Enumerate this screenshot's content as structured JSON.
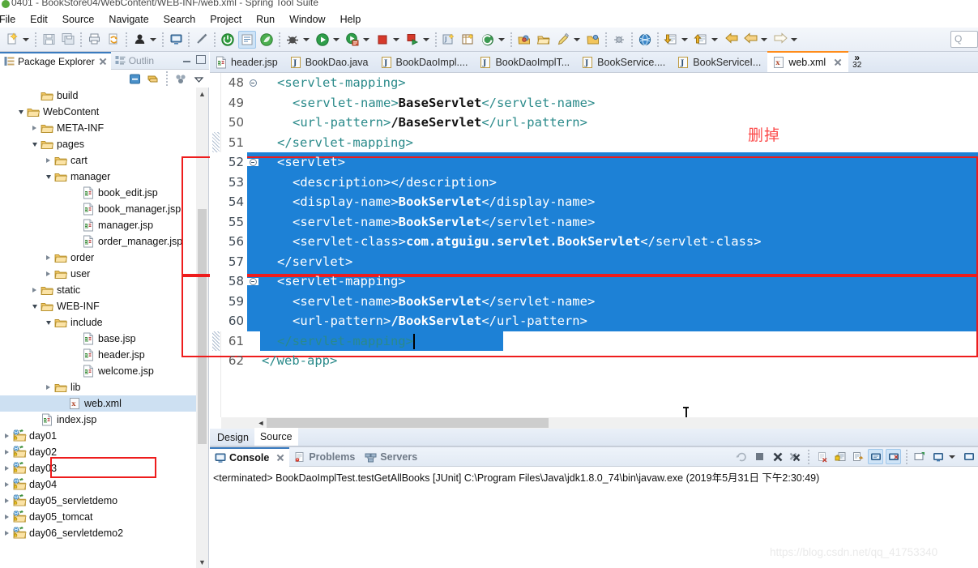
{
  "window": {
    "title": "0401 - BookStore04/WebContent/WEB-INF/web.xml - Spring Tool Suite",
    "app_icon": "sts-icon"
  },
  "menubar": {
    "items": [
      "File",
      "Edit",
      "Source",
      "Navigate",
      "Search",
      "Project",
      "Run",
      "Window",
      "Help"
    ]
  },
  "toolbar": {
    "search_placeholder": "Q",
    "icons": [
      "new-wizard-icon",
      "save-icon",
      "save-all-icon",
      "print-icon",
      "refresh-icon",
      "person-icon",
      "console-icon",
      "link-off-icon",
      "power-icon",
      "edit-config-icon",
      "leaf-icon",
      "debug-icon",
      "run-icon",
      "run-server-icon",
      "stop-icon",
      "external-tools-icon",
      "new-java-class-icon",
      "new-package-icon",
      "git-icon",
      "open-type-icon",
      "open-resource-icon",
      "pencil-icon",
      "open-folder-icon",
      "search-bug-icon",
      "globe-icon",
      "next-annotation-icon",
      "previous-annotation-icon",
      "back-history-icon",
      "back-icon",
      "forward-icon"
    ]
  },
  "left_panel": {
    "tabs": [
      {
        "label": "Package Explorer",
        "icon": "package-explorer-icon",
        "active": true,
        "closable": true
      },
      {
        "label": "Outlin",
        "icon": "outline-icon",
        "active": false,
        "closable": false
      }
    ],
    "view_toolbar": [
      "collapse-all-icon",
      "link-with-editor-icon",
      "focus-icon",
      "view-menu-icon"
    ],
    "tree": [
      {
        "label": "build",
        "icon": "folder-icon",
        "indent": 2,
        "twist": "none",
        "selected": false
      },
      {
        "label": "WebContent",
        "icon": "folder-icon",
        "indent": 1,
        "twist": "down",
        "selected": false
      },
      {
        "label": "META-INF",
        "icon": "folder-icon",
        "indent": 2,
        "twist": "right",
        "selected": false
      },
      {
        "label": "pages",
        "icon": "folder-icon",
        "indent": 2,
        "twist": "down",
        "selected": false
      },
      {
        "label": "cart",
        "icon": "folder-icon",
        "indent": 3,
        "twist": "right",
        "selected": false
      },
      {
        "label": "manager",
        "icon": "folder-icon",
        "indent": 3,
        "twist": "down",
        "selected": false
      },
      {
        "label": "book_edit.jsp",
        "icon": "jsp-file-icon",
        "indent": 5,
        "twist": "none",
        "selected": false
      },
      {
        "label": "book_manager.jsp",
        "icon": "jsp-file-icon",
        "indent": 5,
        "twist": "none",
        "selected": false
      },
      {
        "label": "manager.jsp",
        "icon": "jsp-file-icon",
        "indent": 5,
        "twist": "none",
        "selected": false
      },
      {
        "label": "order_manager.jsp",
        "icon": "jsp-file-icon",
        "indent": 5,
        "twist": "none",
        "selected": false
      },
      {
        "label": "order",
        "icon": "folder-icon",
        "indent": 3,
        "twist": "right",
        "selected": false
      },
      {
        "label": "user",
        "icon": "folder-icon",
        "indent": 3,
        "twist": "right",
        "selected": false
      },
      {
        "label": "static",
        "icon": "folder-icon",
        "indent": 2,
        "twist": "right",
        "selected": false
      },
      {
        "label": "WEB-INF",
        "icon": "folder-icon",
        "indent": 2,
        "twist": "down",
        "selected": false
      },
      {
        "label": "include",
        "icon": "folder-icon",
        "indent": 3,
        "twist": "down",
        "selected": false
      },
      {
        "label": "base.jsp",
        "icon": "jsp-file-icon",
        "indent": 5,
        "twist": "none",
        "selected": false
      },
      {
        "label": "header.jsp",
        "icon": "jsp-file-icon",
        "indent": 5,
        "twist": "none",
        "selected": false
      },
      {
        "label": "welcome.jsp",
        "icon": "jsp-file-icon",
        "indent": 5,
        "twist": "none",
        "selected": false
      },
      {
        "label": "lib",
        "icon": "folder-icon",
        "indent": 3,
        "twist": "right",
        "selected": false
      },
      {
        "label": "web.xml",
        "icon": "xml-file-icon",
        "indent": 4,
        "twist": "none",
        "selected": true
      },
      {
        "label": "index.jsp",
        "icon": "jsp-file-icon",
        "indent": 2,
        "twist": "none",
        "selected": false
      },
      {
        "label": "day01",
        "icon": "web-project-icon",
        "indent": 0,
        "twist": "right",
        "selected": false
      },
      {
        "label": "day02",
        "icon": "web-project-icon",
        "indent": 0,
        "twist": "right",
        "selected": false
      },
      {
        "label": "day03",
        "icon": "web-project-icon",
        "indent": 0,
        "twist": "right",
        "selected": false
      },
      {
        "label": "day04",
        "icon": "web-project-icon",
        "indent": 0,
        "twist": "right",
        "selected": false
      },
      {
        "label": "day05_servletdemo",
        "icon": "web-project-icon",
        "indent": 0,
        "twist": "right",
        "selected": false
      },
      {
        "label": "day05_tomcat",
        "icon": "web-project-icon",
        "indent": 0,
        "twist": "right",
        "selected": false
      },
      {
        "label": "day06_servletdemo2",
        "icon": "web-project-icon",
        "indent": 0,
        "twist": "right",
        "selected": false
      }
    ]
  },
  "editor": {
    "tabs": [
      {
        "label": "header.jsp",
        "icon": "jsp-file-icon",
        "active": false
      },
      {
        "label": "BookDao.java",
        "icon": "java-file-icon",
        "active": false
      },
      {
        "label": "BookDaoImpl....",
        "icon": "java-file-icon",
        "active": false
      },
      {
        "label": "BookDaoImplT...",
        "icon": "java-file-icon",
        "active": false
      },
      {
        "label": "BookService....",
        "icon": "java-file-icon",
        "active": false
      },
      {
        "label": "BookServiceI...",
        "icon": "java-file-icon",
        "active": false
      },
      {
        "label": "web.xml",
        "icon": "xml-file-icon",
        "active": true
      }
    ],
    "overflow_chevron": "»",
    "overflow_count": "32",
    "bottom_tabs": [
      {
        "label": "Design",
        "active": false
      },
      {
        "label": "Source",
        "active": true
      }
    ],
    "code_lines": [
      {
        "num": "48",
        "fold": true,
        "indent": 1,
        "selected": false,
        "parts": [
          {
            "t": "tag",
            "s": "<servlet-mapping>"
          }
        ]
      },
      {
        "num": "49",
        "fold": false,
        "indent": 2,
        "selected": false,
        "parts": [
          {
            "t": "tag",
            "s": "<servlet-name>"
          },
          {
            "t": "txt",
            "s": "BaseServlet"
          },
          {
            "t": "tag",
            "s": "</servlet-name>"
          }
        ]
      },
      {
        "num": "50",
        "fold": false,
        "indent": 2,
        "selected": false,
        "parts": [
          {
            "t": "tag",
            "s": "<url-pattern>"
          },
          {
            "t": "txt",
            "s": "/BaseServlet"
          },
          {
            "t": "tag",
            "s": "</url-pattern>"
          }
        ]
      },
      {
        "num": "51",
        "fold": false,
        "indent": 1,
        "selected": false,
        "parts": [
          {
            "t": "tag",
            "s": "</servlet-mapping>"
          }
        ]
      },
      {
        "num": "52",
        "fold": true,
        "indent": 1,
        "selected": true,
        "parts": [
          {
            "t": "tag",
            "s": "<servlet>"
          }
        ]
      },
      {
        "num": "53",
        "fold": false,
        "indent": 2,
        "selected": true,
        "parts": [
          {
            "t": "tag",
            "s": "<description></description>"
          }
        ]
      },
      {
        "num": "54",
        "fold": false,
        "indent": 2,
        "selected": true,
        "parts": [
          {
            "t": "tag",
            "s": "<display-name>"
          },
          {
            "t": "txt",
            "s": "BookServlet"
          },
          {
            "t": "tag",
            "s": "</display-name>"
          }
        ]
      },
      {
        "num": "55",
        "fold": false,
        "indent": 2,
        "selected": true,
        "parts": [
          {
            "t": "tag",
            "s": "<servlet-name>"
          },
          {
            "t": "txt",
            "s": "BookServlet"
          },
          {
            "t": "tag",
            "s": "</servlet-name>"
          }
        ]
      },
      {
        "num": "56",
        "fold": false,
        "indent": 2,
        "selected": true,
        "parts": [
          {
            "t": "tag",
            "s": "<servlet-class>"
          },
          {
            "t": "txt",
            "s": "com.atguigu.servlet.BookServlet"
          },
          {
            "t": "tag",
            "s": "</servlet-class>"
          }
        ]
      },
      {
        "num": "57",
        "fold": false,
        "indent": 1,
        "selected": true,
        "parts": [
          {
            "t": "tag",
            "s": "</servlet>"
          }
        ]
      },
      {
        "num": "58",
        "fold": true,
        "indent": 1,
        "selected": true,
        "parts": [
          {
            "t": "tag",
            "s": "<servlet-mapping>"
          }
        ]
      },
      {
        "num": "59",
        "fold": false,
        "indent": 2,
        "selected": true,
        "parts": [
          {
            "t": "tag",
            "s": "<servlet-name>"
          },
          {
            "t": "txt",
            "s": "BookServlet"
          },
          {
            "t": "tag",
            "s": "</servlet-name>"
          }
        ]
      },
      {
        "num": "60",
        "fold": false,
        "indent": 2,
        "selected": true,
        "parts": [
          {
            "t": "tag",
            "s": "<url-pattern>"
          },
          {
            "t": "txt",
            "s": "/BookServlet"
          },
          {
            "t": "tag",
            "s": "</url-pattern>"
          }
        ]
      },
      {
        "num": "61",
        "fold": false,
        "indent": 1,
        "selected": "partial",
        "selwidth": 300,
        "caret": true,
        "parts": [
          {
            "t": "tag",
            "s": "</servlet-mapping>"
          }
        ]
      },
      {
        "num": "62",
        "fold": false,
        "indent": 0,
        "selected": false,
        "parts": [
          {
            "t": "tag",
            "s": "</web-app>"
          }
        ]
      }
    ]
  },
  "annotation": {
    "note_text": "删掉",
    "note_color": "#fc4a4a",
    "box_color": "#ee1c1c"
  },
  "console": {
    "tabs": [
      {
        "label": "Console",
        "icon": "console-icon",
        "active": true,
        "closable": true
      },
      {
        "label": "Problems",
        "icon": "problems-icon",
        "active": false,
        "closable": false
      },
      {
        "label": "Servers",
        "icon": "servers-icon",
        "active": false,
        "closable": false
      }
    ],
    "toolbar_icons": [
      "terminate-relaunch-icon",
      "terminate-icon",
      "remove-launch-icon",
      "remove-all-terminated-icon",
      "clear-console-icon",
      "scroll-lock-icon",
      "word-wrap-icon",
      "show-console-on-output-icon",
      "show-console-on-error-icon",
      "pin-console-icon",
      "display-selected-console-icon",
      "console-dropdown-icon",
      "open-console-icon"
    ],
    "output": "<terminated> BookDaoImplTest.testGetAllBooks [JUnit] C:\\Program Files\\Java\\jdk1.8.0_74\\bin\\javaw.exe (2019年5月31日 下午2:30:49)"
  },
  "watermark": {
    "text": "https://blog.csdn.net/qq_41753340"
  }
}
